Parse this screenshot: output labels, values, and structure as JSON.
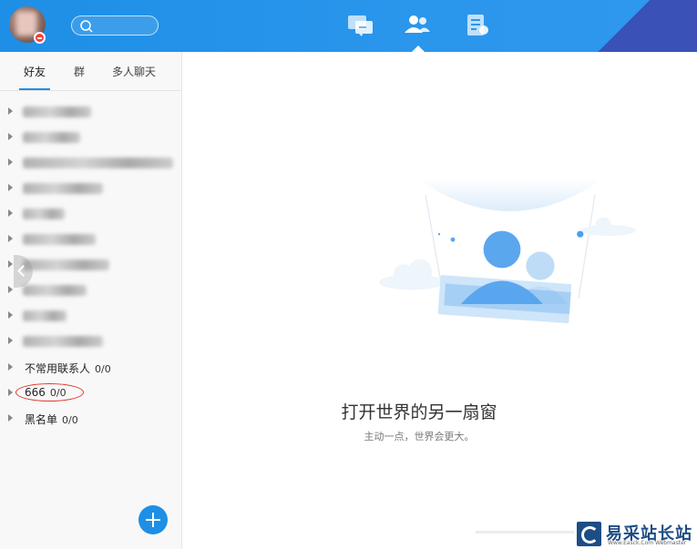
{
  "tabs": [
    {
      "label": "好友"
    },
    {
      "label": "群"
    },
    {
      "label": "多人聊天"
    }
  ],
  "groups": [
    {
      "label": "不常用联系人",
      "count": "0/0"
    },
    {
      "label": "666",
      "count": "0/0"
    },
    {
      "label": "黑名单",
      "count": "0/0"
    }
  ],
  "empty_state": {
    "title": "打开世界的另一扇窗",
    "subtitle": "主动一点，世界会更大。"
  },
  "watermark": {
    "title": "易采站长站",
    "subtitle": "Www.Easck.Com Webmaster"
  },
  "icons": {
    "search": "search-icon",
    "messages": "chat-icon",
    "contacts": "contacts-icon",
    "feeds": "document-icon",
    "add": "plus-icon"
  },
  "colors": {
    "accent": "#1e8fe6",
    "annotation": "#e2352d"
  }
}
